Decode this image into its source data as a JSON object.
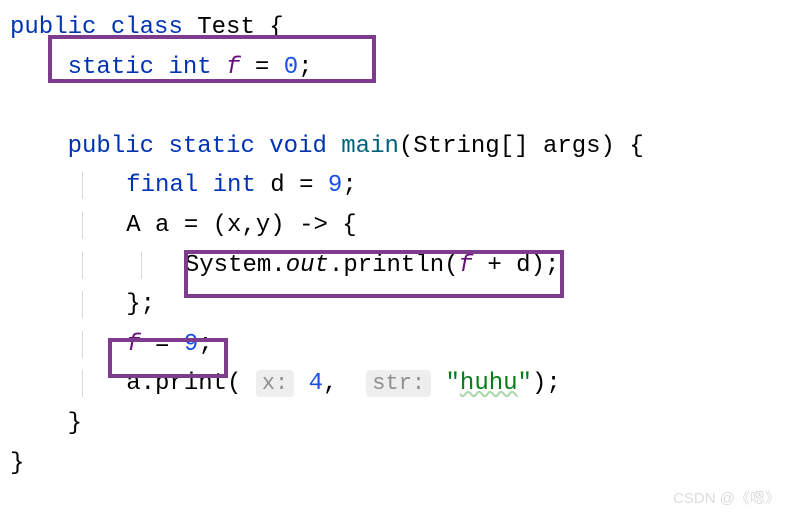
{
  "code": {
    "line1": {
      "public": "public",
      "class": "class",
      "Test": "Test",
      "brace": " {"
    },
    "line2": {
      "static": "static",
      "int": "int",
      "f": "f",
      "eq": " = ",
      "zero": "0",
      "semi": ";"
    },
    "line4": {
      "public": "public",
      "static": "static",
      "void": "void",
      "main": "main",
      "paren_open": "(",
      "String": "String",
      "brackets": "[] ",
      "args": "args",
      "paren_close_brace": ") {"
    },
    "line5": {
      "final": "final",
      "int": "int",
      "d": "d",
      "eq": " = ",
      "nine": "9",
      "semi": ";"
    },
    "line6": {
      "A": "A",
      "a": " a = (x,y) -> {"
    },
    "line7": {
      "System": "System",
      "dot1": ".",
      "out": "out",
      "dot2": ".",
      "println": "println",
      "paren_open": "(",
      "f": "f",
      "plus": " + ",
      "d": "d",
      "paren_close_semi": ");"
    },
    "line8": {
      "close": "};"
    },
    "line9": {
      "f": "f",
      "eq": " = ",
      "nine": "9",
      "semi": ";"
    },
    "line10": {
      "a_print": "a.print( ",
      "hint_x": "x:",
      "sp1": " ",
      "four": "4",
      "comma_sp": ",  ",
      "hint_str": "str:",
      "sp2": " ",
      "huhu_q1": "\"",
      "huhu": "huhu",
      "huhu_q2": "\"",
      "end": ");"
    },
    "line11": {
      "close": "}"
    },
    "line12": {
      "close": "}"
    }
  },
  "watermark": "CSDN @《嗯》"
}
